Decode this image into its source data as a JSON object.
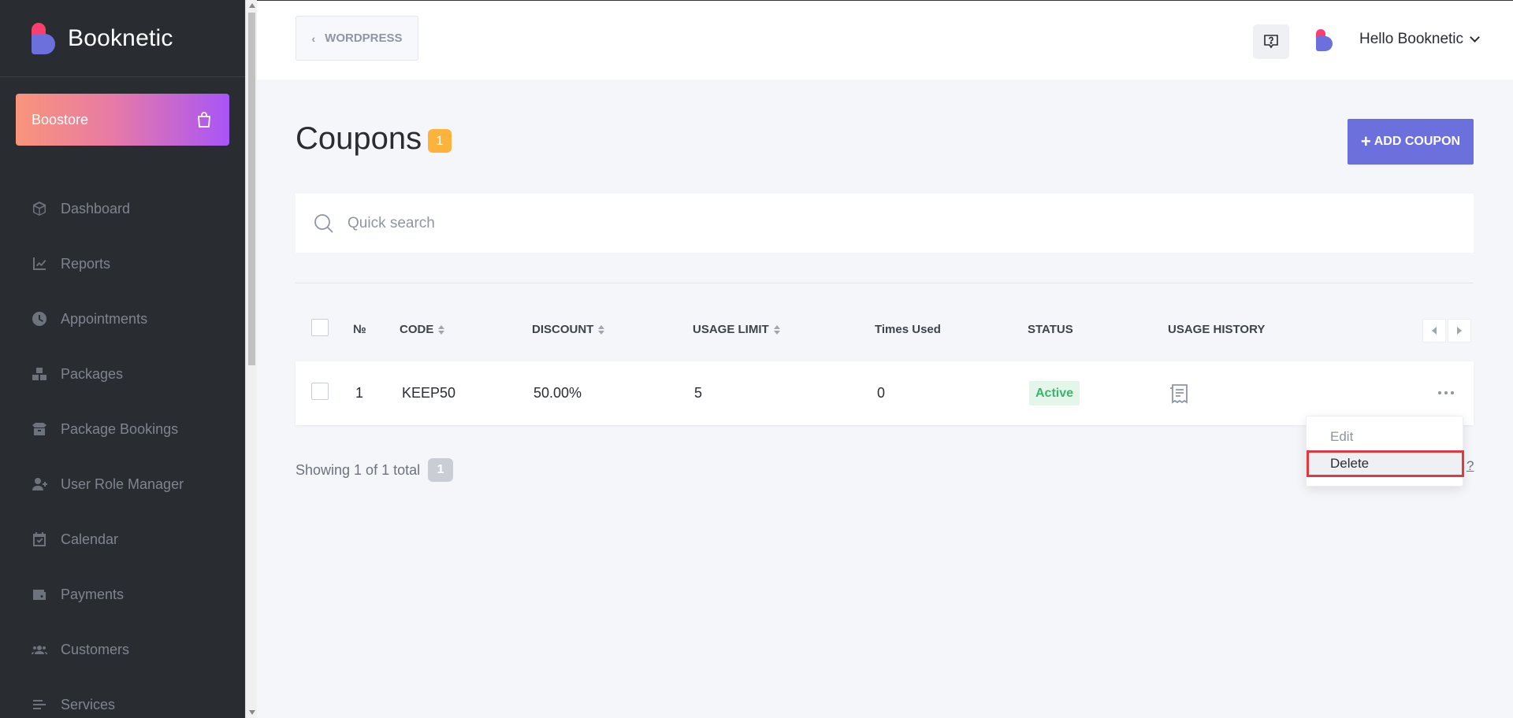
{
  "app": {
    "brand": "Booknetic"
  },
  "sidebar": {
    "boostore_label": "Boostore",
    "items": [
      {
        "label": "Dashboard",
        "icon": "cube-icon"
      },
      {
        "label": "Reports",
        "icon": "chart-line-icon"
      },
      {
        "label": "Appointments",
        "icon": "clock-icon"
      },
      {
        "label": "Packages",
        "icon": "boxes-icon"
      },
      {
        "label": "Package Bookings",
        "icon": "box-open-icon"
      },
      {
        "label": "User Role Manager",
        "icon": "user-plus-icon"
      },
      {
        "label": "Calendar",
        "icon": "calendar-check-icon"
      },
      {
        "label": "Payments",
        "icon": "wallet-icon"
      },
      {
        "label": "Customers",
        "icon": "users-icon"
      },
      {
        "label": "Services",
        "icon": "list-icon"
      }
    ]
  },
  "topbar": {
    "back_label": "WORDPRESS",
    "user_greeting": "Hello Booknetic"
  },
  "page": {
    "title": "Coupons",
    "count": "1",
    "add_button": "ADD COUPON"
  },
  "search": {
    "placeholder": "Quick search"
  },
  "table": {
    "columns": {
      "no": "№",
      "code": "CODE",
      "discount": "DISCOUNT",
      "usage_limit": "USAGE LIMIT",
      "times_used": "Times Used",
      "status": "STATUS",
      "usage_history": "USAGE HISTORY"
    },
    "rows": [
      {
        "no": "1",
        "code": "KEEP50",
        "discount": "50.00%",
        "usage_limit": "5",
        "times_used": "0",
        "status": "Active"
      }
    ]
  },
  "footer": {
    "showing": "Showing 1 of 1 total",
    "total": "1",
    "q": "?"
  },
  "context_menu": {
    "edit": "Edit",
    "delete": "Delete"
  },
  "colors": {
    "accent": "#6c70dc",
    "sidebar_bg": "#292d32",
    "badge": "#fcb33c",
    "status_active": "#3bb56c",
    "highlight": "#e03a3e"
  }
}
